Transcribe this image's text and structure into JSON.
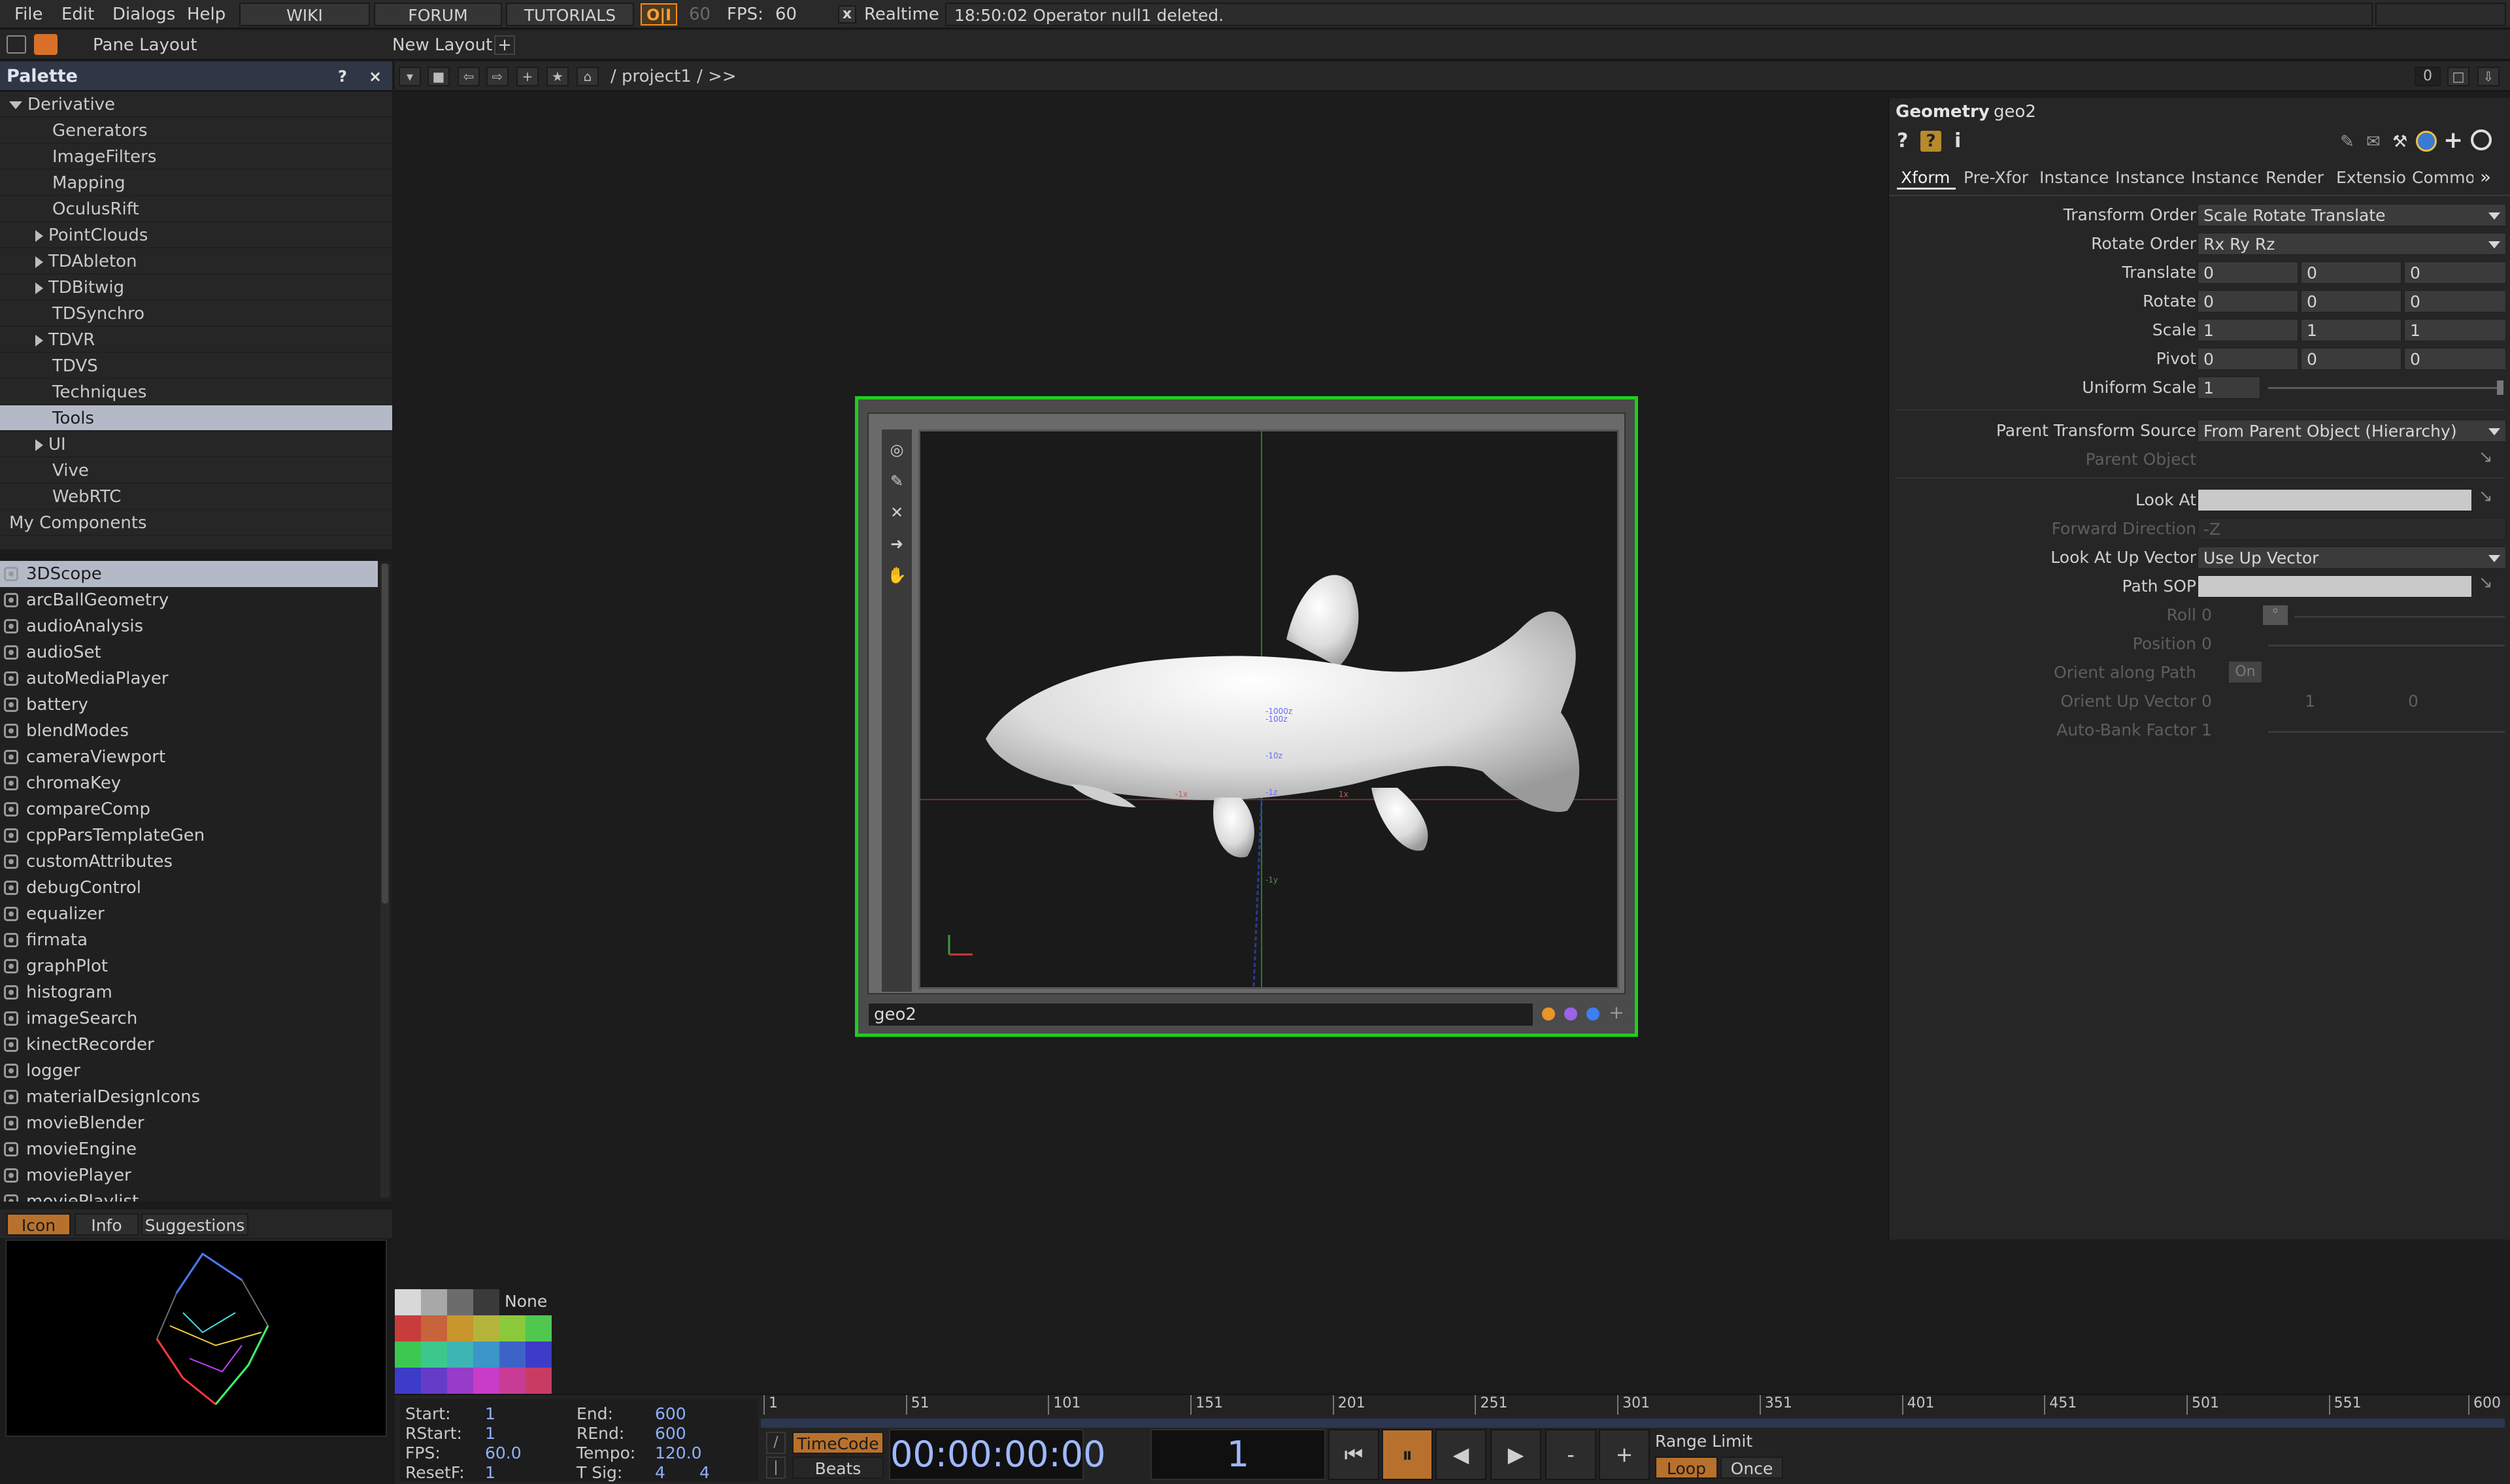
{
  "menubar": {
    "items": [
      "File",
      "Edit",
      "Dialogs",
      "Help"
    ],
    "buttons": [
      "WIKI",
      "FORUM",
      "TUTORIALS"
    ],
    "oi_badge": "O|I",
    "fps_cap": "60",
    "fps_label": "FPS:",
    "fps_value": "60",
    "realtime_check": "x",
    "realtime_label": "Realtime",
    "status_message": "18:50:02 Operator null1 deleted."
  },
  "panebar": {
    "pane_layout_label": "Pane Layout",
    "new_layout_label": "New Layout",
    "add_label": "+"
  },
  "palette": {
    "title": "Palette",
    "help_label": "?",
    "close_label": "×",
    "folders": [
      {
        "label": "Derivative",
        "indent": 0,
        "arrow": "down"
      },
      {
        "label": "Generators",
        "indent": 2,
        "arrow": "none"
      },
      {
        "label": "ImageFilters",
        "indent": 2,
        "arrow": "none"
      },
      {
        "label": "Mapping",
        "indent": 2,
        "arrow": "none"
      },
      {
        "label": "OculusRift",
        "indent": 2,
        "arrow": "none"
      },
      {
        "label": "PointClouds",
        "indent": 1,
        "arrow": "right"
      },
      {
        "label": "TDAbleton",
        "indent": 1,
        "arrow": "right"
      },
      {
        "label": "TDBitwig",
        "indent": 1,
        "arrow": "right"
      },
      {
        "label": "TDSynchro",
        "indent": 2,
        "arrow": "none"
      },
      {
        "label": "TDVR",
        "indent": 1,
        "arrow": "right"
      },
      {
        "label": "TDVS",
        "indent": 2,
        "arrow": "none"
      },
      {
        "label": "Techniques",
        "indent": 2,
        "arrow": "none"
      },
      {
        "label": "Tools",
        "indent": 2,
        "arrow": "none",
        "selected": true
      },
      {
        "label": "UI",
        "indent": 1,
        "arrow": "right"
      },
      {
        "label": "Vive",
        "indent": 2,
        "arrow": "none"
      },
      {
        "label": "WebRTC",
        "indent": 2,
        "arrow": "none"
      },
      {
        "label": "My Components",
        "indent": 0,
        "arrow": "none"
      }
    ],
    "components": [
      {
        "label": "3DScope",
        "selected": true
      },
      {
        "label": "arcBallGeometry"
      },
      {
        "label": "audioAnalysis"
      },
      {
        "label": "audioSet"
      },
      {
        "label": "autoMediaPlayer"
      },
      {
        "label": "battery"
      },
      {
        "label": "blendModes"
      },
      {
        "label": "cameraViewport"
      },
      {
        "label": "chromaKey"
      },
      {
        "label": "compareComp"
      },
      {
        "label": "cppParsTemplateGen"
      },
      {
        "label": "customAttributes"
      },
      {
        "label": "debugControl"
      },
      {
        "label": "equalizer"
      },
      {
        "label": "firmata"
      },
      {
        "label": "graphPlot"
      },
      {
        "label": "histogram"
      },
      {
        "label": "imageSearch"
      },
      {
        "label": "kinectRecorder"
      },
      {
        "label": "logger"
      },
      {
        "label": "materialDesignIcons"
      },
      {
        "label": "movieBlender"
      },
      {
        "label": "movieEngine"
      },
      {
        "label": "moviePlayer"
      },
      {
        "label": "moviePlaylist"
      }
    ],
    "preview_tabs": [
      "Icon",
      "Info",
      "Suggestions"
    ]
  },
  "network": {
    "path": "/ project1 / >>",
    "counter": "0",
    "node": {
      "name": "geo2",
      "axis_labels": [
        "-1000z",
        "-100z",
        "-10z",
        "-1z",
        "-1x",
        "1x",
        "-1y"
      ],
      "flag_colors": [
        "#e8952a",
        "#9a63e8",
        "#3c7ff0"
      ],
      "add_flag": "+"
    }
  },
  "params": {
    "op_type": "Geometry",
    "op_name": "geo2",
    "tabs": [
      "Xform",
      "Pre-Xfor",
      "Instance",
      "Instance",
      "Instance",
      "Render",
      "Extensio",
      "Commor"
    ],
    "more_tabs": "»",
    "rows": {
      "transform_order": {
        "label": "Transform Order",
        "value": "Scale Rotate Translate"
      },
      "rotate_order": {
        "label": "Rotate Order",
        "value": "Rx Ry Rz"
      },
      "translate": {
        "label": "Translate",
        "x": "0",
        "y": "0",
        "z": "0"
      },
      "rotate": {
        "label": "Rotate",
        "x": "0",
        "y": "0",
        "z": "0"
      },
      "scale": {
        "label": "Scale",
        "x": "1",
        "y": "1",
        "z": "1"
      },
      "pivot": {
        "label": "Pivot",
        "x": "0",
        "y": "0",
        "z": "0"
      },
      "uniform_scale": {
        "label": "Uniform Scale",
        "value": "1"
      },
      "parent_transform_source": {
        "label": "Parent Transform Source",
        "value": "From Parent Object (Hierarchy)"
      },
      "parent_object": {
        "label": "Parent Object"
      },
      "look_at": {
        "label": "Look At"
      },
      "forward_direction": {
        "label": "Forward Direction",
        "value": "-Z"
      },
      "look_at_up_vector": {
        "label": "Look At Up Vector",
        "value": "Use Up Vector"
      },
      "path_sop": {
        "label": "Path SOP"
      },
      "roll": {
        "label": "Roll",
        "value": "0",
        "unit": "°"
      },
      "position": {
        "label": "Position",
        "value": "0"
      },
      "orient_along_path": {
        "label": "Orient along Path",
        "value": "On"
      },
      "orient_up_vector": {
        "label": "Orient Up Vector",
        "x": "0",
        "y": "1",
        "z": "0"
      },
      "auto_bank_factor": {
        "label": "Auto-Bank Factor",
        "value": "1"
      }
    }
  },
  "swatches": {
    "none_label": "None",
    "colors": [
      [
        "#d8d8d8",
        "#a8a8a8",
        "#6c6c6c",
        "#3a3a3a"
      ],
      [
        "#c83c3c",
        "#c8643c",
        "#c8962c",
        "#b4b43c",
        "#8cc83c",
        "#50c850"
      ],
      [
        "#3cc850",
        "#3cc88c",
        "#3cb4b4",
        "#3c96c8",
        "#3c64c8",
        "#3c3cc8"
      ],
      [
        "#3c3cc8",
        "#643cc8",
        "#963cc8",
        "#c83cc8",
        "#c83c96",
        "#c83c64"
      ]
    ]
  },
  "timeline": {
    "info": {
      "start": {
        "label": "Start:",
        "value": "1"
      },
      "end": {
        "label": "End:",
        "value": "600"
      },
      "rstart": {
        "label": "RStart:",
        "value": "1"
      },
      "rend": {
        "label": "REnd:",
        "value": "600"
      },
      "fps": {
        "label": "FPS:",
        "value": "60.0"
      },
      "tempo": {
        "label": "Tempo:",
        "value": "120.0"
      },
      "resetf": {
        "label": "ResetF:",
        "value": "1"
      },
      "tsig": {
        "label": "T Sig:",
        "value_a": "4",
        "value_b": "4"
      }
    },
    "ruler_ticks": [
      "1",
      "51",
      "101",
      "151",
      "201",
      "251",
      "301",
      "351",
      "401",
      "451",
      "501",
      "551",
      "600"
    ],
    "timecode_label": "TimeCode",
    "beats_label": "Beats",
    "timecode_value": "00:00:00:00",
    "frame_value": "1",
    "range_limit_label": "Range Limit",
    "loop_label": "Loop",
    "once_label": "Once",
    "minus_label": "-",
    "plus_label": "+"
  }
}
